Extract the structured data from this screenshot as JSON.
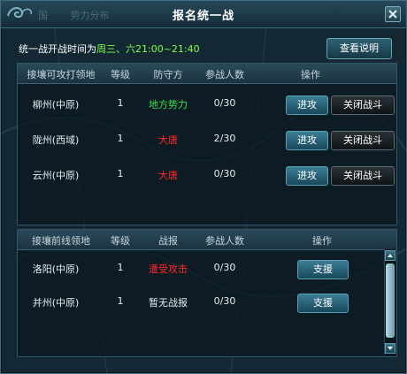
{
  "window": {
    "title": "报名统一战",
    "ghost_tabs": [
      "国",
      "势力分布"
    ]
  },
  "info": {
    "prefix": "统一战开战时间为",
    "highlight": "周三、六21:00~21:40",
    "help_button": "查看说明"
  },
  "attack_table": {
    "headers": [
      "接壤可攻打领地",
      "等级",
      "防守方",
      "参战人数",
      "操作"
    ],
    "rows": [
      {
        "territory": "柳州(中原)",
        "level": "1",
        "defender": "地方势力",
        "participants": "0/30",
        "attack": "进攻",
        "close": "关闭战斗"
      },
      {
        "territory": "陇州(西域)",
        "level": "1",
        "defender": "大唐",
        "participants": "2/30",
        "attack": "进攻",
        "close": "关闭战斗"
      },
      {
        "territory": "云州(中原)",
        "level": "1",
        "defender": "大唐",
        "participants": "0/30",
        "attack": "进攻",
        "close": "关闭战斗"
      }
    ]
  },
  "front_table": {
    "headers": [
      "接壤前线领地",
      "等级",
      "战报",
      "参战人数",
      "操作"
    ],
    "rows": [
      {
        "territory": "洛阳(中原)",
        "level": "1",
        "report": "遭受攻击",
        "participants": "0/30",
        "support": "支援"
      },
      {
        "territory": "并州(中原)",
        "level": "1",
        "report": "暂无战报",
        "participants": "0/30",
        "support": "支援"
      }
    ]
  },
  "colors": {
    "green": "#35e04f",
    "red": "#ff2a2a",
    "highlight": "#7dff4a"
  },
  "icons": [
    "swirl-ornament-icon",
    "close-icon",
    "scroll-up-arrow-icon",
    "scroll-down-arrow-icon"
  ]
}
